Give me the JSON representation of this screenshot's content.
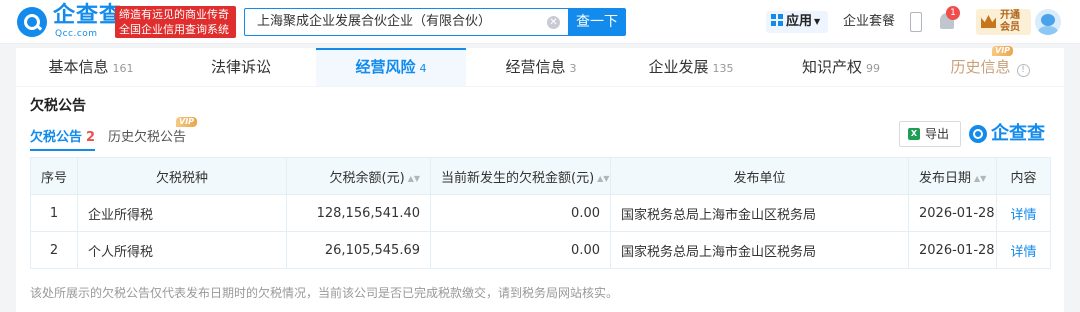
{
  "header": {
    "logo_text": "企查查",
    "logo_sub": "Qcc.com",
    "slogan_line1": "缔造有远见的商业传奇",
    "slogan_line2": "全国企业信用查询系统",
    "search_value": "上海聚成企业发展合伙企业（有限合伙）",
    "search_button": "查一下",
    "apps_label": "应用",
    "enterprise_package": "企业套餐",
    "notification_count": "1",
    "vip_line1": "开通",
    "vip_line2": "会员"
  },
  "nav": {
    "tabs": [
      {
        "label": "基本信息",
        "count": "161"
      },
      {
        "label": "法律诉讼",
        "count": ""
      },
      {
        "label": "经营风险",
        "count": "4"
      },
      {
        "label": "经营信息",
        "count": "3"
      },
      {
        "label": "企业发展",
        "count": "135"
      },
      {
        "label": "知识产权",
        "count": "99"
      },
      {
        "label": "历史信息",
        "count": ""
      }
    ],
    "vip_tag": "VIP"
  },
  "section": {
    "title": "欠税公告",
    "subtab_active": "欠税公告",
    "subtab_active_count": "2",
    "subtab_history": "历史欠税公告",
    "subtab_vip": "VIP",
    "export_label": "导出",
    "export_icon_text": "X",
    "brand": "企查查"
  },
  "table": {
    "headers": [
      "序号",
      "欠税税种",
      "欠税余额(元)",
      "当前新发生的欠税金额(元)",
      "发布单位",
      "发布日期",
      "内容"
    ],
    "rows": [
      {
        "no": "1",
        "tax_type": "企业所得税",
        "balance": "128,156,541.40",
        "new_amount": "0.00",
        "issuer": "国家税务总局上海市金山区税务局",
        "date": "2026-01-28",
        "content": "详情"
      },
      {
        "no": "2",
        "tax_type": "个人所得税",
        "balance": "26,105,545.69",
        "new_amount": "0.00",
        "issuer": "国家税务总局上海市金山区税务局",
        "date": "2026-01-28",
        "content": "详情"
      }
    ]
  },
  "footnote": "该处所展示的欠税公告仅代表发布日期时的欠税情况，当前该公司是否已完成税款缴交，请到税务局网站核实。",
  "colors": {
    "brand_blue": "#128bed",
    "alert_red": "#e02d2d",
    "vip_gold": "#c8761d"
  }
}
